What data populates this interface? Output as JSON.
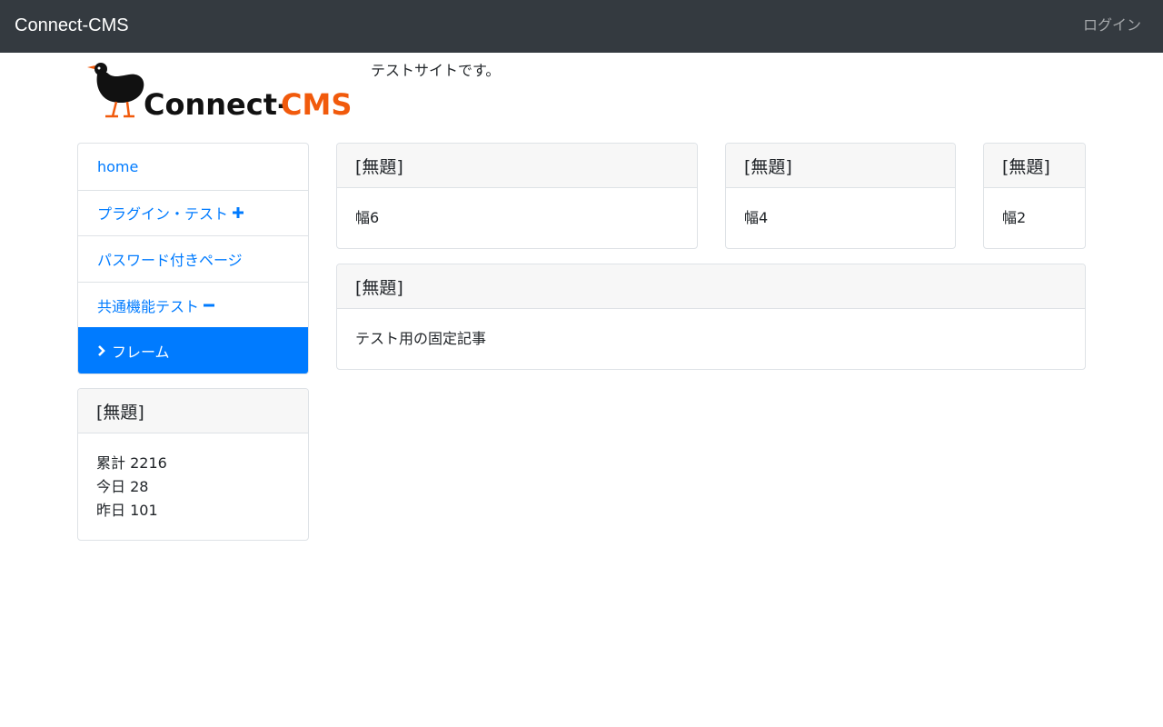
{
  "navbar": {
    "brand": "Connect-CMS",
    "login_label": "ログイン"
  },
  "header": {
    "logo_alt": "Connect-CMS",
    "logo_text_a": "Connect-",
    "logo_text_b": "CMS",
    "tagline": "テストサイトです。"
  },
  "sidebar": {
    "items": [
      {
        "label": "home",
        "icon": "",
        "active": false
      },
      {
        "label": "プラグイン・テスト",
        "icon": "plus-icon",
        "active": false
      },
      {
        "label": "パスワード付きページ",
        "icon": "",
        "active": false
      },
      {
        "label": "共通機能テスト",
        "icon": "minus-icon",
        "active": false
      },
      {
        "label": "フレーム",
        "icon": "chevron-right-icon",
        "active": true
      }
    ]
  },
  "counter": {
    "title": "[無題]",
    "total": "累計 2216",
    "today": "今日 28",
    "yesterday": "昨日 101"
  },
  "frames": [
    {
      "title": "[無題]",
      "body": "幅6"
    },
    {
      "title": "[無題]",
      "body": "幅4"
    },
    {
      "title": "[無題]",
      "body": "幅2"
    },
    {
      "title": "[無題]",
      "body": "テスト用の固定記事"
    }
  ],
  "colors": {
    "navbar_bg": "#343a40",
    "link": "#007bff",
    "active_bg": "#007bff",
    "logo_orange": "#f15a0c"
  }
}
